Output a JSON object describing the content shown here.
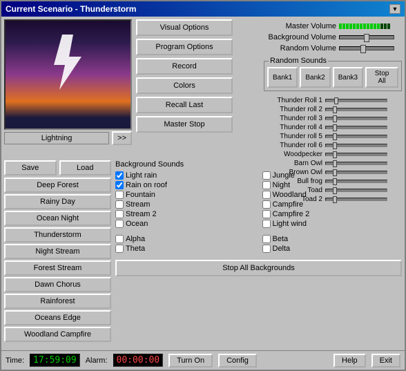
{
  "window": {
    "title": "Current Scenario - Thunderstorm",
    "close_label": "▼"
  },
  "preview": {
    "label": "Lightning",
    "arrow_label": ">>"
  },
  "middle_buttons": {
    "visual_options": "Visual Options",
    "program_options": "Program Options",
    "record": "Record",
    "colors": "Colors",
    "recall_last": "Recall Last",
    "master_stop": "Master Stop"
  },
  "volumes": {
    "master_label": "Master Volume",
    "background_label": "Background Volume",
    "random_label": "Random Volume",
    "master_fill": 75,
    "background_fill": 50,
    "random_fill": 45
  },
  "random_sounds": {
    "title": "Random Sounds",
    "bank1": "Bank1",
    "bank2": "Bank2",
    "bank3": "Bank3",
    "stop_all": "Stop All",
    "sounds": [
      {
        "label": "Thunder Roll 1",
        "pos": 12
      },
      {
        "label": "Thunder roll 2",
        "pos": 10
      },
      {
        "label": "Thunder roll 3",
        "pos": 10
      },
      {
        "label": "Thunder roll 4",
        "pos": 10
      },
      {
        "label": "Thunder roll 5",
        "pos": 10
      },
      {
        "label": "Thunder roll 6",
        "pos": 10
      },
      {
        "label": "Woodpecker",
        "pos": 10
      },
      {
        "label": "Barn Owl",
        "pos": 10
      },
      {
        "label": "Brown Owl",
        "pos": 10
      },
      {
        "label": "Bull frog",
        "pos": 10
      },
      {
        "label": "Toad",
        "pos": 10
      },
      {
        "label": "Toad 2",
        "pos": 10
      }
    ]
  },
  "left_panel": {
    "save": "Save",
    "load": "Load",
    "scenarios": [
      "Deep Forest",
      "Rainy Day",
      "Ocean Night",
      "Thunderstorm",
      "Night Stream",
      "Forest Stream",
      "Dawn Chorus",
      "Rainforest",
      "Oceans Edge",
      "Woodland Campfire"
    ]
  },
  "bg_sounds": {
    "title": "Background Sounds",
    "sounds_col1": [
      {
        "label": "Light rain",
        "checked": true
      },
      {
        "label": "Rain on roof",
        "checked": true
      },
      {
        "label": "Fountain",
        "checked": false
      },
      {
        "label": "Stream",
        "checked": false
      },
      {
        "label": "Stream 2",
        "checked": false
      },
      {
        "label": "Ocean",
        "checked": false
      }
    ],
    "sounds_col2": [
      {
        "label": "Jungle",
        "checked": false
      },
      {
        "label": "Night",
        "checked": false
      },
      {
        "label": "Woodland",
        "checked": false
      },
      {
        "label": "Campfire",
        "checked": false
      },
      {
        "label": "Campfire 2",
        "checked": false
      },
      {
        "label": "Light wind",
        "checked": false
      }
    ],
    "greek_col1": [
      {
        "label": "Alpha",
        "checked": false
      },
      {
        "label": "Theta",
        "checked": false
      }
    ],
    "greek_col2": [
      {
        "label": "Beta",
        "checked": false
      },
      {
        "label": "Delta",
        "checked": false
      }
    ],
    "stop_all_label": "Stop All Backgrounds"
  },
  "status_bar": {
    "time_label": "Time:",
    "time_value": "17:59:09",
    "alarm_label": "Alarm:",
    "alarm_value": "00:00:00",
    "turn_on": "Turn On",
    "config": "Config",
    "help": "Help",
    "exit": "Exit"
  }
}
